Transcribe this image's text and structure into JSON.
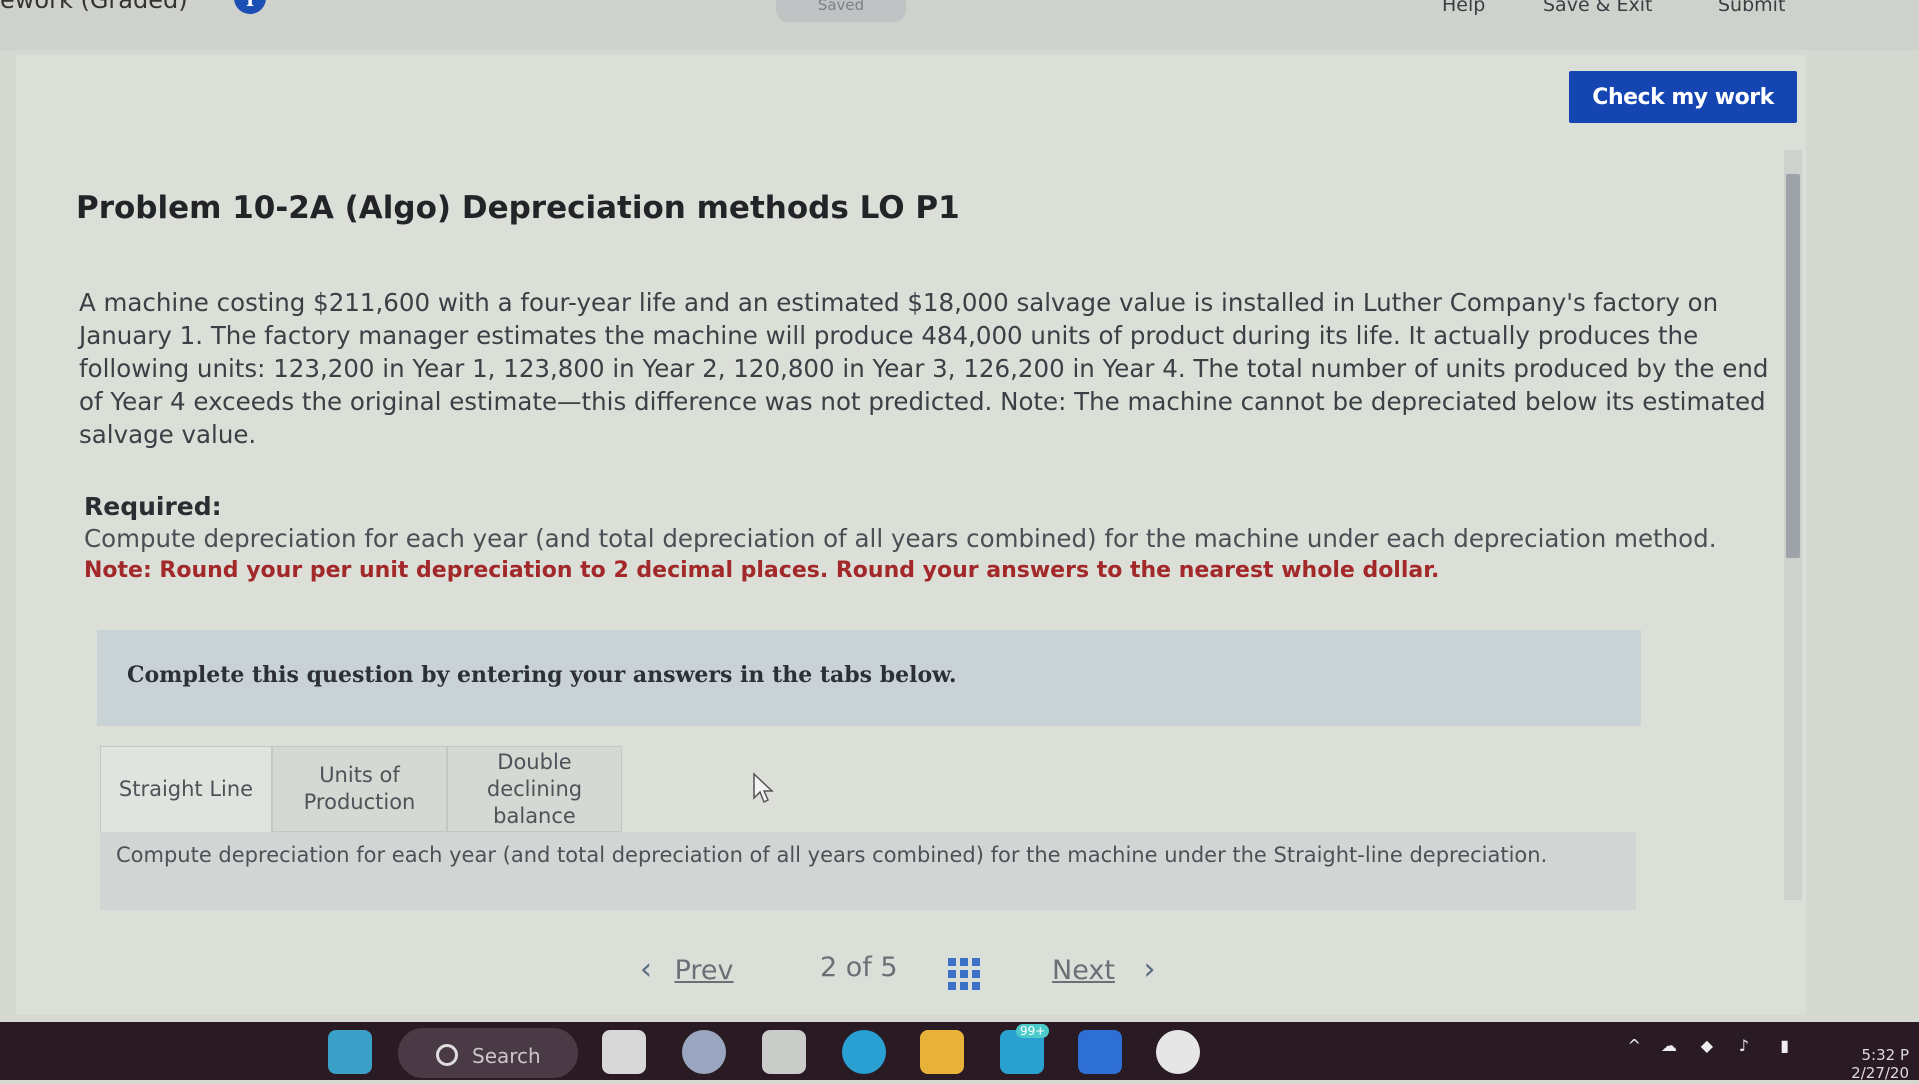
{
  "topbar": {
    "title": "ework (Graded)",
    "saved_label": "Saved",
    "help": "Help",
    "save_exit": "Save & Exit",
    "submit": "Submit"
  },
  "check_button": "Check my work",
  "problem": {
    "title": "Problem 10-2A (Algo) Depreciation methods LO P1",
    "text": "A machine costing $211,600 with a four-year life and an estimated $18,000 salvage value is installed in Luther Company's factory on January 1. The factory manager estimates the machine will produce 484,000 units of product during its life. It actually produces the following units: 123,200 in Year 1, 123,800 in Year 2, 120,800 in Year 3, 126,200 in Year 4. The total number of units produced by the end of Year 4 exceeds the original estimate—this difference was not predicted. Note: The machine cannot be depreciated below its estimated salvage value.",
    "required_label": "Required:",
    "required_text": "Compute depreciation for each year (and total depreciation of all years combined) for the machine under each depreciation method.",
    "required_note": "Note: Round your per unit depreciation to 2 decimal places. Round your answers to the nearest whole dollar."
  },
  "complete_box": "Complete this question by entering your answers in the tabs below.",
  "tabs": [
    {
      "label": "Straight Line"
    },
    {
      "label": "Units of Production"
    },
    {
      "label": "Double declining balance"
    }
  ],
  "tab_panel_text": "Compute depreciation for each year (and total depreciation of all years combined) for the machine under the Straight-line depreciation.",
  "pager": {
    "prev": "Prev",
    "count": "2 of 5",
    "next": "Next"
  },
  "taskbar": {
    "search": "Search",
    "badge": "99+",
    "time": "5:32 P",
    "date": "2/27/20"
  }
}
